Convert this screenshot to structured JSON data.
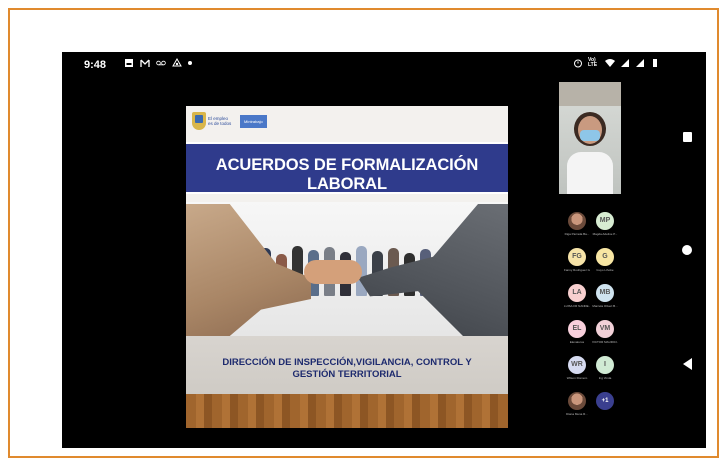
{
  "statusbar": {
    "time": "9:48",
    "left_icons": [
      "gallery-icon",
      "gmail-icon",
      "voicemail-icon",
      "sync-icon"
    ],
    "right_text": "Vo) LTE",
    "right_icons": [
      "alarm-icon",
      "volte-icon",
      "wifi-icon",
      "signal-icon",
      "signal-icon",
      "battery-icon"
    ]
  },
  "slide": {
    "logo_line1": "El empleo",
    "logo_line2": "es de todos",
    "logo_tag": "Mintrabajo",
    "title": "ACUERDOS DE FORMALIZACIÓN LABORAL",
    "footer_line1": "DIRECCIÓN DE INSPECCIÓN,VIGILANCIA, CONTROL Y",
    "footer_line2": "GESTIÓN TERRITORIAL"
  },
  "participants": [
    {
      "initials": "",
      "name": "Diga Parrada Ba...",
      "color": "#e8d6c2",
      "photo": true
    },
    {
      "initials": "MP",
      "name": "Magda Adeline P...",
      "color": "#d7ecd2",
      "photo": false
    },
    {
      "initials": "FG",
      "name": "Fanny Rodriguez G...",
      "color": "#f6e3a8",
      "photo": false
    },
    {
      "initials": "G",
      "name": "Guyo Lthobe",
      "color": "#f8e6a3",
      "photo": false
    },
    {
      "initials": "LA",
      "name": "LUISA FR NANDE...",
      "color": "#f7cfcf",
      "photo": false
    },
    {
      "initials": "MB",
      "name": "Marcela Oliveri B...",
      "color": "#cfe3ef",
      "photo": false
    },
    {
      "initials": "EL",
      "name": "Elenaturos",
      "color": "#f8d0dc",
      "photo": false
    },
    {
      "initials": "VM",
      "name": "VICTOR MAURICI...",
      "color": "#f2d1d8",
      "photo": false
    },
    {
      "initials": "WR",
      "name": "Wilson Romero",
      "color": "#d6dbf1",
      "photo": false
    },
    {
      "initials": "I",
      "name": "Ing Vinda",
      "color": "#d0ead4",
      "photo": false
    },
    {
      "initials": "",
      "name": "Diana Mena R...",
      "color": "#ddd",
      "photo": true
    },
    {
      "initials": "+1",
      "name": "",
      "color": "#3a3f8f",
      "photo": false
    }
  ],
  "nav": [
    "recents-button",
    "home-button",
    "back-button"
  ]
}
